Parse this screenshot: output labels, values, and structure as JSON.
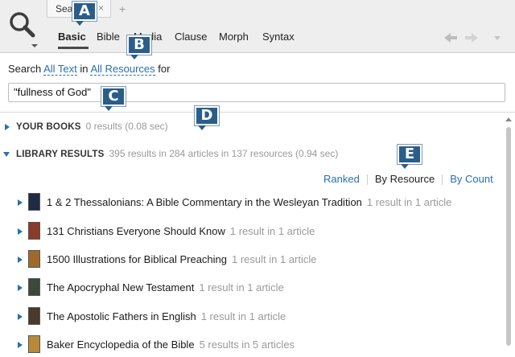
{
  "tab": {
    "label": "Sear",
    "close": "×",
    "add": "+"
  },
  "modes": [
    "Basic",
    "Bible",
    "Media",
    "Clause",
    "Morph",
    "Syntax"
  ],
  "search_row": {
    "prefix": "Search",
    "scope": "All Text",
    "mid": "in",
    "collection": "All Resources",
    "suffix": "for"
  },
  "query": {
    "value": "\"fullness of God\""
  },
  "your_books": {
    "title": "YOUR BOOKS",
    "meta": "0 results (0.08 sec)"
  },
  "library_results": {
    "title": "LIBRARY RESULTS",
    "meta": "395 results in 284 articles in 137 resources (0.94 sec)"
  },
  "sort": {
    "ranked": "Ranked",
    "by_resource": "By Resource",
    "by_count": "By Count"
  },
  "results": [
    {
      "title": "1 & 2 Thessalonians: A Bible Commentary in the Wesleyan Tradition",
      "meta": "1 result in 1 article",
      "cover_color": "#1f2a44"
    },
    {
      "title": "131 Christians Everyone Should Know",
      "meta": "1 result in 1 article",
      "cover_color": "#8a3b2a"
    },
    {
      "title": "1500 Illustrations for Biblical Preaching",
      "meta": "1 result in 1 article",
      "cover_color": "#a06a2a"
    },
    {
      "title": "The Apocryphal New Testament",
      "meta": "1 result in 1 article",
      "cover_color": "#3a4a3a"
    },
    {
      "title": "The Apostolic Fathers in English",
      "meta": "1 result in 1 article",
      "cover_color": "#4a3a2a"
    },
    {
      "title": "Baker Encyclopedia of the Bible",
      "meta": "5 results in 5 articles",
      "cover_color": "#b8893a"
    }
  ],
  "callouts": [
    "A",
    "B",
    "C",
    "D",
    "E"
  ],
  "colors": {
    "accent": "#2a6fb0",
    "callout": "#2a5d8a",
    "muted": "#999999"
  }
}
